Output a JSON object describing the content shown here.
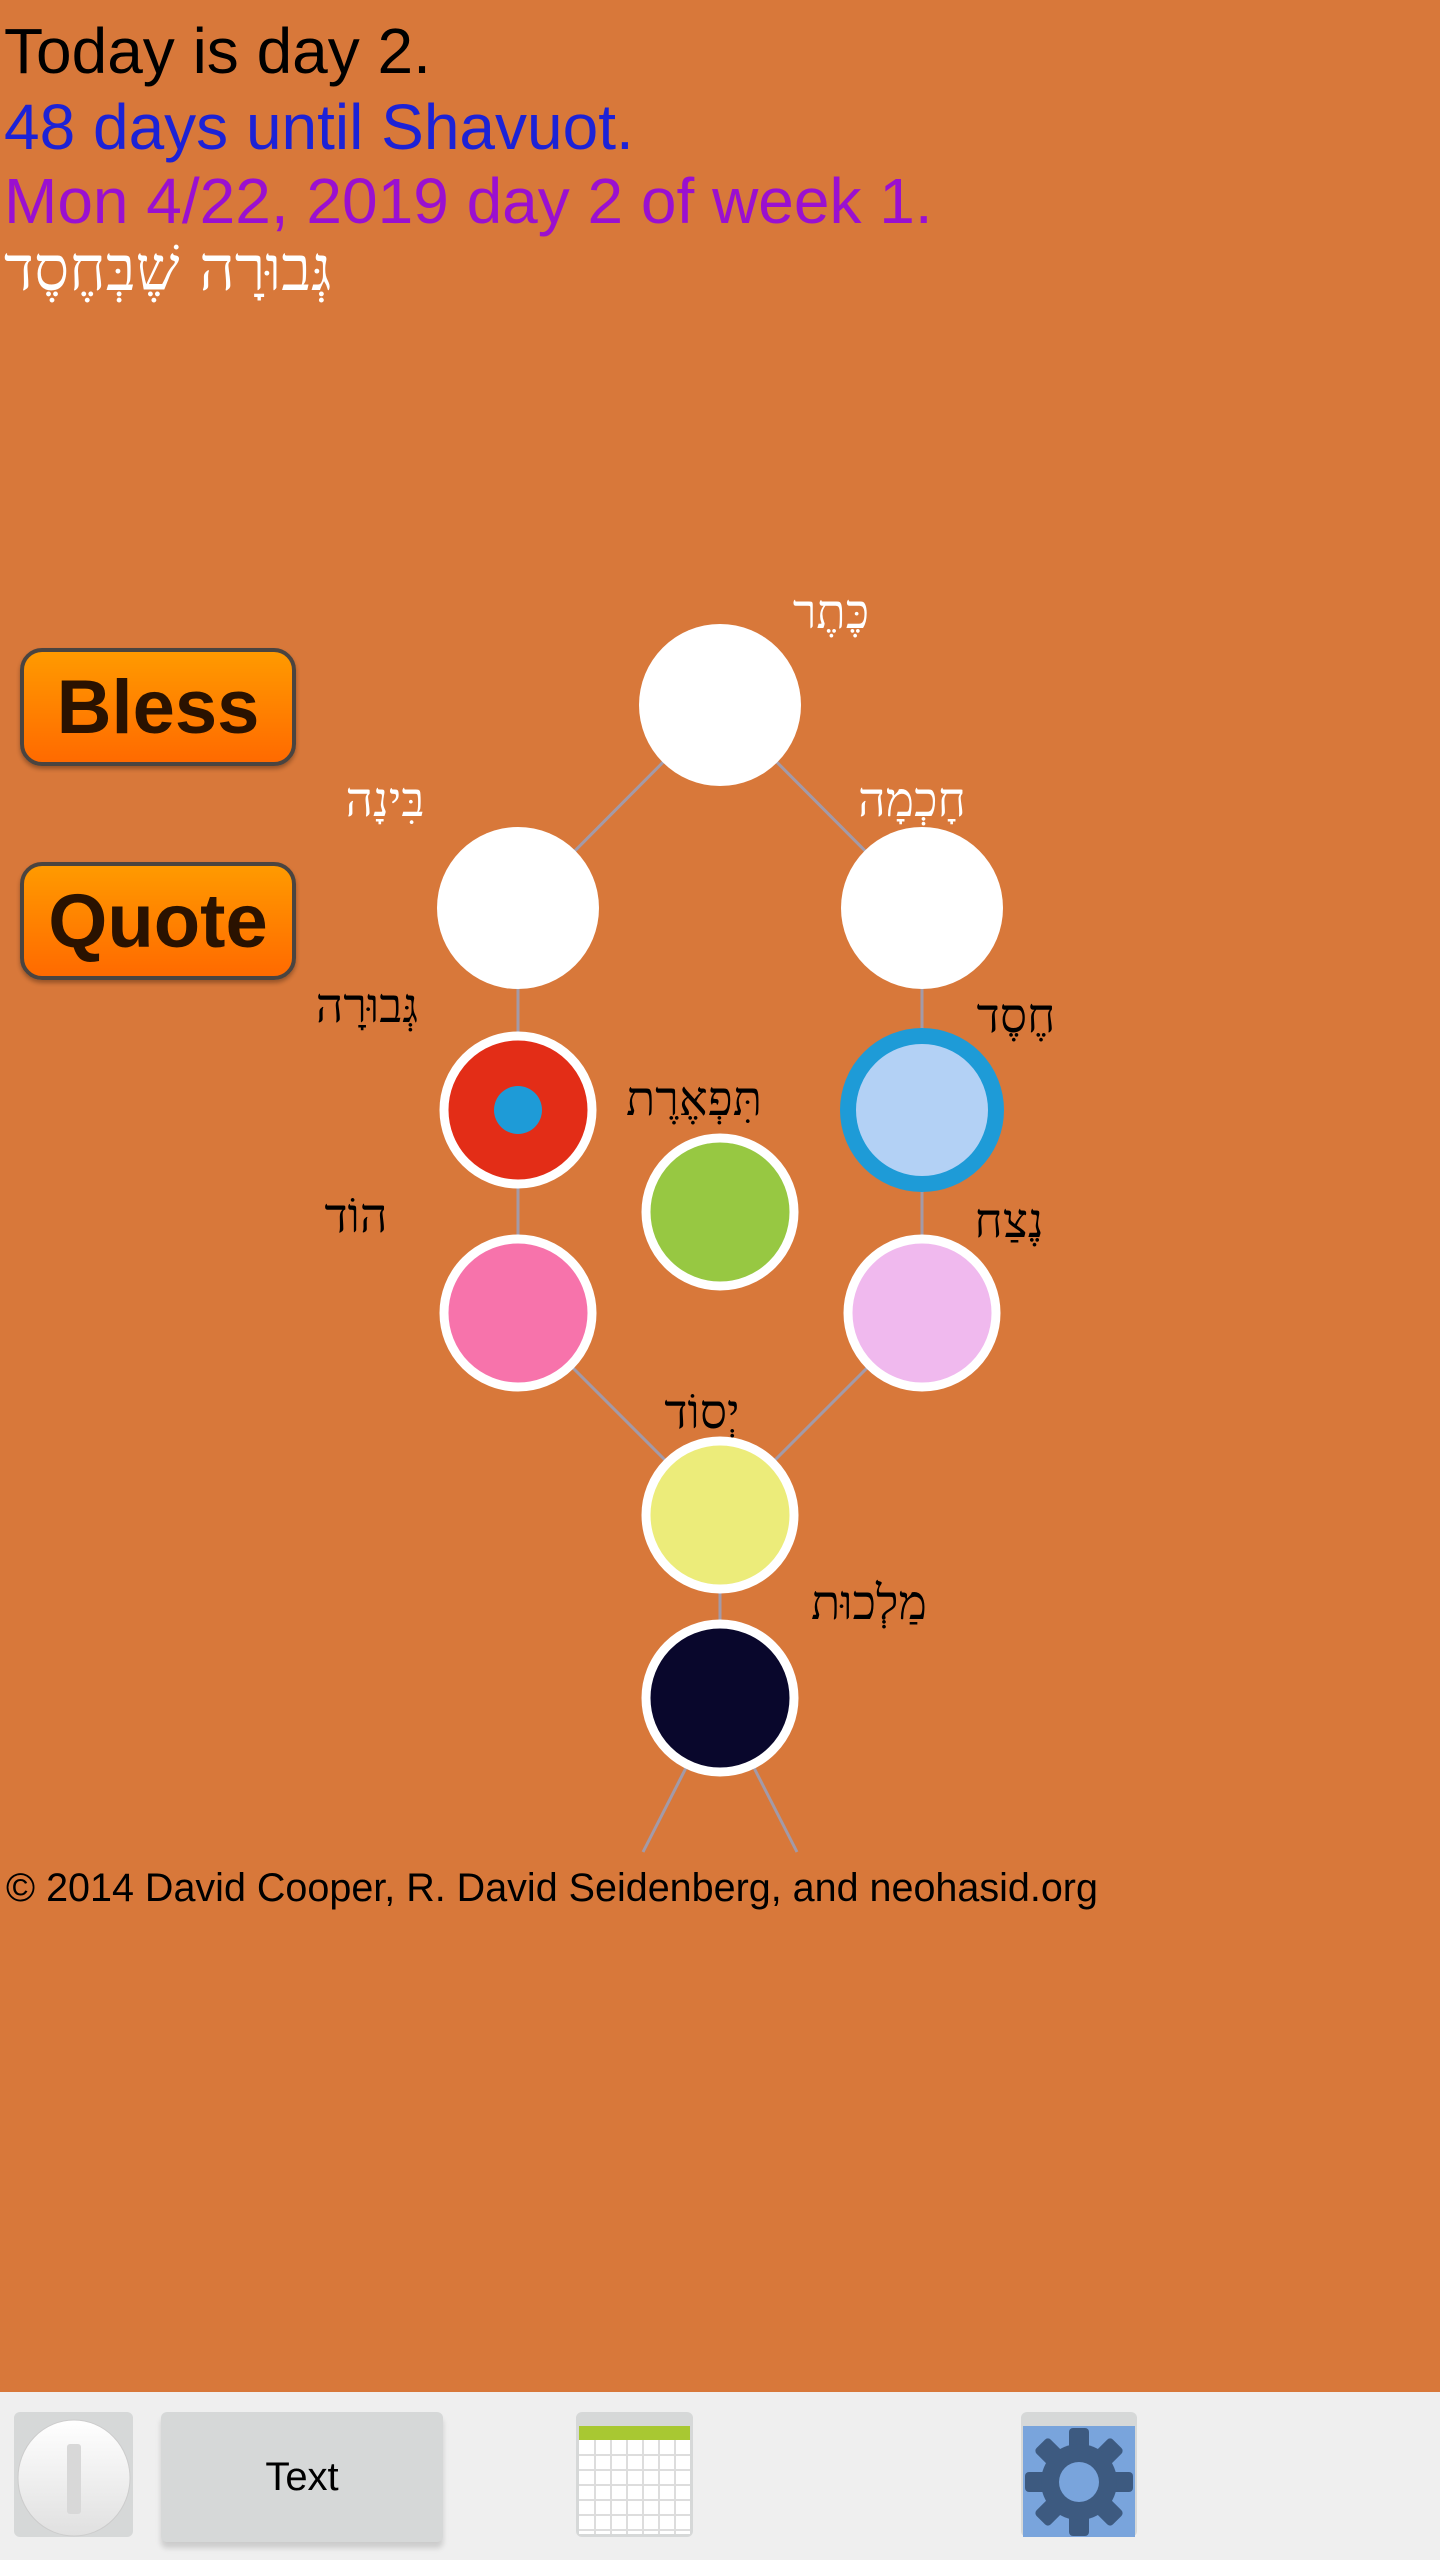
{
  "header": {
    "day_line": "Today is day 2.",
    "countdown_line": "48 days until Shavuot.",
    "date_line": "Mon 4/22, 2019 day 2 of week 1.",
    "sefirah_of_day": "גְּבוּרָה שֶׁבְּחֶסֶד"
  },
  "buttons": {
    "bless": "Bless",
    "quote": "Quote"
  },
  "tree": {
    "line_color": "#a39aa8",
    "nodes": [
      {
        "id": "keter",
        "label": "כֶּתֶר",
        "fill": "#ffffff",
        "label_color": "#ffffff"
      },
      {
        "id": "binah",
        "label": "בִּינָה",
        "fill": "#ffffff",
        "label_color": "#ffffff"
      },
      {
        "id": "chokhmah",
        "label": "חָכְמָה",
        "fill": "#ffffff",
        "label_color": "#ffffff"
      },
      {
        "id": "gevurah",
        "label": "גְּבוּרָה",
        "fill": "#e32d17",
        "inner_dot": "#1e9bd7",
        "label_color": "#000000"
      },
      {
        "id": "chesed",
        "label": "חֶסֶד",
        "fill": "#b3d1f5",
        "ring": "#1e9bd7",
        "label_color": "#000000"
      },
      {
        "id": "tiferet",
        "label": "תִּפְאֶרֶת",
        "fill": "#97c842",
        "label_color": "#000000"
      },
      {
        "id": "hod",
        "label": "הוֹד",
        "fill": "#f773ab",
        "label_color": "#000000"
      },
      {
        "id": "netzach",
        "label": "נֶצַח",
        "fill": "#f0b9ee",
        "label_color": "#000000"
      },
      {
        "id": "yesod",
        "label": "יְסוֹד",
        "fill": "#ecec7a",
        "label_color": "#000000"
      },
      {
        "id": "malkhut",
        "label": "מַלְכוּת",
        "fill": "#09072c",
        "label_color": "#000000"
      }
    ]
  },
  "copyright": "© 2014 David Cooper, R. David Seidenberg, and neohasid.org",
  "toolbar": {
    "info_icon": "info-icon",
    "text_label": "Text",
    "calendar_icon": "calendar-icon",
    "settings_icon": "gear-icon"
  },
  "colors": {
    "background": "#d8783a",
    "toolbar": "#efefef"
  }
}
